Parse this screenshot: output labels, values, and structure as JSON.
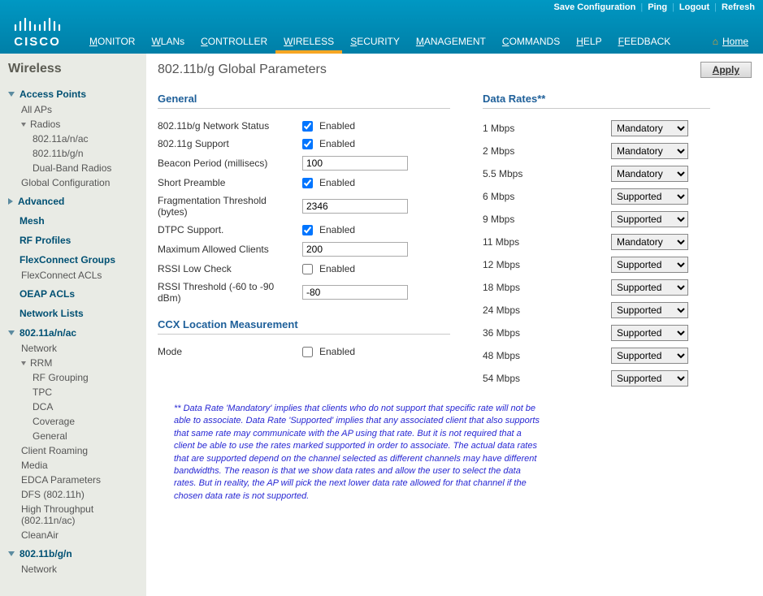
{
  "header": {
    "top_links": [
      "Save Configuration",
      "Ping",
      "Logout",
      "Refresh"
    ],
    "brand": "CISCO",
    "nav": [
      "MONITOR",
      "WLANs",
      "CONTROLLER",
      "WIRELESS",
      "SECURITY",
      "MANAGEMENT",
      "COMMANDS",
      "HELP",
      "FEEDBACK"
    ],
    "nav_active_index": 3,
    "home": "Home"
  },
  "sidebar": {
    "title": "Wireless",
    "sections": [
      {
        "label": "Access Points",
        "expanded": true,
        "children": [
          {
            "label": "All APs"
          },
          {
            "label": "Radios",
            "expanded": true,
            "children": [
              {
                "label": "802.11a/n/ac"
              },
              {
                "label": "802.11b/g/n"
              },
              {
                "label": "Dual-Band Radios"
              }
            ]
          },
          {
            "label": "Global Configuration"
          }
        ]
      },
      {
        "label": "Advanced",
        "expanded": false
      },
      {
        "label": "Mesh",
        "expanded": null
      },
      {
        "label": "RF Profiles",
        "expanded": null
      },
      {
        "label": "FlexConnect Groups",
        "expanded": null,
        "children": [
          {
            "label": "FlexConnect ACLs"
          }
        ]
      },
      {
        "label": "OEAP ACLs",
        "expanded": null
      },
      {
        "label": "Network Lists",
        "expanded": null
      },
      {
        "label": "802.11a/n/ac",
        "expanded": true,
        "children": [
          {
            "label": "Network"
          },
          {
            "label": "RRM",
            "expanded": true,
            "children": [
              {
                "label": "RF Grouping"
              },
              {
                "label": "TPC"
              },
              {
                "label": "DCA"
              },
              {
                "label": "Coverage"
              },
              {
                "label": "General"
              }
            ]
          },
          {
            "label": "Client Roaming"
          },
          {
            "label": "Media"
          },
          {
            "label": "EDCA Parameters"
          },
          {
            "label": "DFS (802.11h)"
          },
          {
            "label": "High Throughput (802.11n/ac)"
          },
          {
            "label": "CleanAir"
          }
        ]
      },
      {
        "label": "802.11b/g/n",
        "expanded": true,
        "children": [
          {
            "label": "Network"
          }
        ]
      }
    ]
  },
  "page": {
    "title": "802.11b/g Global Parameters",
    "apply": "Apply"
  },
  "general": {
    "title": "General",
    "rows": [
      {
        "label": "802.11b/g Network Status",
        "type": "check",
        "checked": true,
        "suffix": "Enabled"
      },
      {
        "label": "802.11g Support",
        "type": "check",
        "checked": true,
        "suffix": "Enabled"
      },
      {
        "label": "Beacon Period (millisecs)",
        "type": "text",
        "value": "100"
      },
      {
        "label": "Short Preamble",
        "type": "check",
        "checked": true,
        "suffix": "Enabled"
      },
      {
        "label": "Fragmentation Threshold (bytes)",
        "type": "text",
        "value": "2346"
      },
      {
        "label": "DTPC Support.",
        "type": "check",
        "checked": true,
        "suffix": "Enabled"
      },
      {
        "label": "Maximum Allowed Clients",
        "type": "text",
        "value": "200"
      },
      {
        "label": "RSSI Low Check",
        "type": "check",
        "checked": false,
        "suffix": "Enabled"
      },
      {
        "label": "RSSI Threshold (-60 to -90 dBm)",
        "type": "text",
        "value": "-80"
      }
    ]
  },
  "ccx": {
    "title": "CCX Location Measurement",
    "mode_label": "Mode",
    "mode_checked": false,
    "mode_suffix": "Enabled"
  },
  "rates": {
    "title": "Data Rates**",
    "items": [
      {
        "label": "1 Mbps",
        "value": "Mandatory"
      },
      {
        "label": "2 Mbps",
        "value": "Mandatory"
      },
      {
        "label": "5.5 Mbps",
        "value": "Mandatory"
      },
      {
        "label": "6 Mbps",
        "value": "Supported"
      },
      {
        "label": "9 Mbps",
        "value": "Supported"
      },
      {
        "label": "11 Mbps",
        "value": "Mandatory"
      },
      {
        "label": "12 Mbps",
        "value": "Supported"
      },
      {
        "label": "18 Mbps",
        "value": "Supported"
      },
      {
        "label": "24 Mbps",
        "value": "Supported"
      },
      {
        "label": "36 Mbps",
        "value": "Supported"
      },
      {
        "label": "48 Mbps",
        "value": "Supported"
      },
      {
        "label": "54 Mbps",
        "value": "Supported"
      }
    ]
  },
  "footnote": "** Data Rate 'Mandatory' implies that clients who do not support that specific rate will not be able to associate. Data Rate 'Supported' implies that any associated client that also supports that same rate may communicate with the AP using that rate. But it is not required that a client be able to use the rates marked supported in order to associate. The actual data rates that are supported depend on the channel selected as different channels may have different bandwidths. The reason is that we show data rates and allow the user to select the data rates. But in reality, the AP will pick the next lower data rate allowed for that channel if the chosen data rate is not supported."
}
